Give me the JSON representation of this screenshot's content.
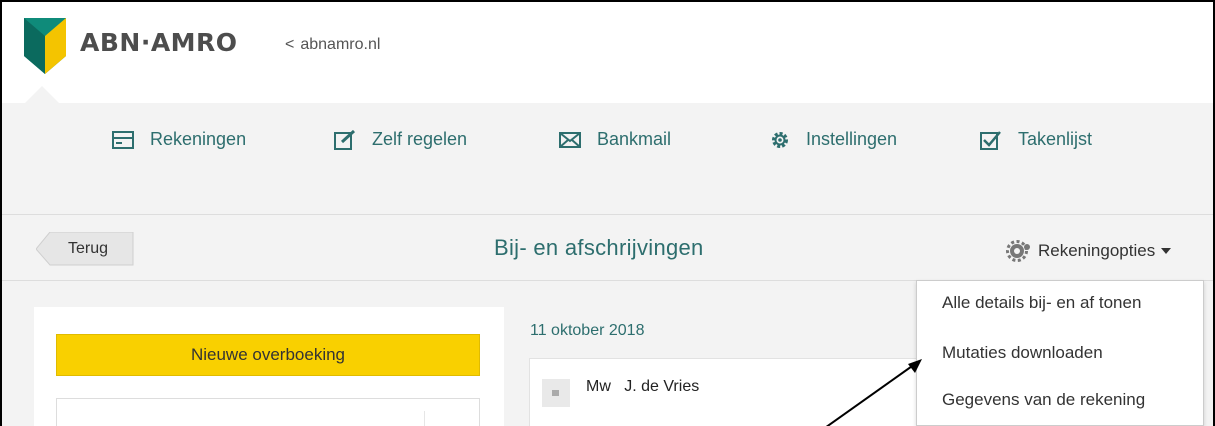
{
  "header": {
    "brand": "ABN·AMRO",
    "back_link": "abnamro.nl"
  },
  "nav": {
    "items": [
      {
        "label": "Rekeningen",
        "icon": "accounts-card-icon"
      },
      {
        "label": "Zelf regelen",
        "icon": "edit-square-icon"
      },
      {
        "label": "Bankmail",
        "icon": "mail-icon"
      },
      {
        "label": "Instellingen",
        "icon": "gear-icon"
      },
      {
        "label": "Takenlijst",
        "icon": "checkbox-icon"
      }
    ]
  },
  "subheader": {
    "back_label": "Terug",
    "title": "Bij- en afschrijvingen",
    "options_label": "Rekeningopties"
  },
  "left_panel": {
    "new_transfer_label": "Nieuwe overboeking"
  },
  "transactions": {
    "date": "11 oktober 2018",
    "first_name": "Mw   J. de Vries"
  },
  "dropdown": {
    "items": [
      "Alle details bij- en af tonen",
      "Mutaties downloaden",
      "Gegevens van de rekening"
    ]
  },
  "colors": {
    "brand_green": "#0f8b7a",
    "brand_yellow": "#f9d000",
    "link_teal": "#2d6e6e"
  }
}
